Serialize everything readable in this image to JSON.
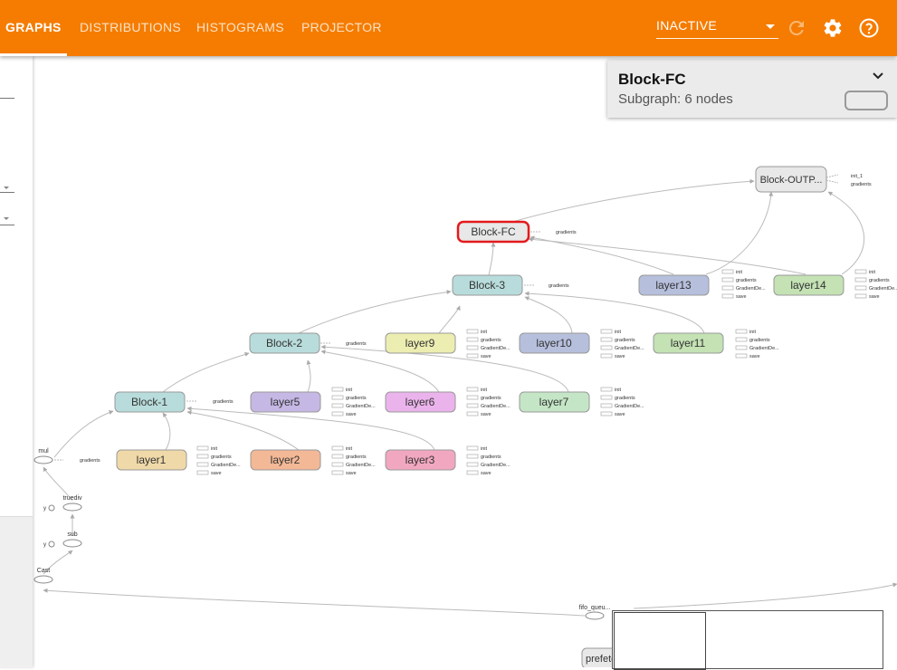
{
  "tabs": [
    {
      "label": "GRAPHS",
      "active": true
    },
    {
      "label": "DISTRIBUTIONS"
    },
    {
      "label": "HISTOGRAMS"
    },
    {
      "label": "PROJECTOR"
    }
  ],
  "run_select": {
    "value": "INACTIVE"
  },
  "icons": {
    "reload": "reload-icon",
    "settings": "gear-icon",
    "help": "help-icon"
  },
  "colors": {
    "header": "#f57c00",
    "block_node": "#b8dcdb",
    "selected_outline": "#e31a1c"
  },
  "info_card": {
    "title": "Block-FC",
    "subtitle": "Subgraph: 6 nodes"
  },
  "nodes": {
    "block_outp": "Block-OUTP...",
    "block_fc": "Block-FC",
    "block_3": "Block-3",
    "block_2": "Block-2",
    "block_1": "Block-1",
    "layer13": "layer13",
    "layer14": "layer14",
    "layer9": "layer9",
    "layer10": "layer10",
    "layer11": "layer11",
    "layer5": "layer5",
    "layer6": "layer6",
    "layer7": "layer7",
    "layer1": "layer1",
    "layer2": "layer2",
    "layer3": "layer3",
    "mul": "mul",
    "truediv": "truediv",
    "sub": "sub",
    "cast": "Cast",
    "fifo": "fifo_queu...",
    "prefetch": "prefetc",
    "y": "y"
  },
  "aux": {
    "init": "init",
    "init_1": "init_1",
    "gradients": "gradients",
    "gradient_de": "GradientDe...",
    "save": "save"
  }
}
